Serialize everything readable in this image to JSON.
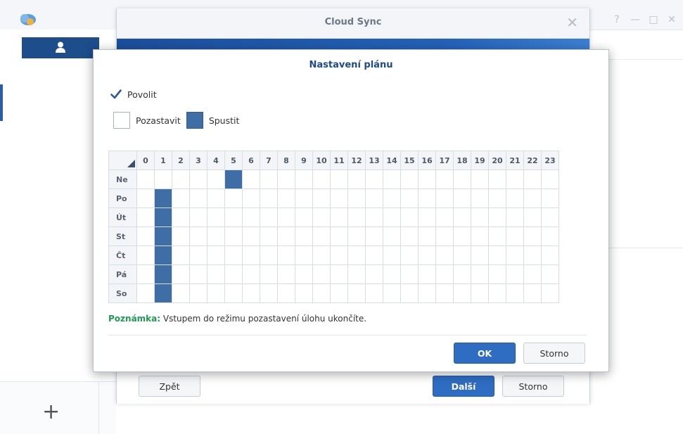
{
  "window_controls": [
    "?",
    "—",
    "□",
    "✕"
  ],
  "wizard": {
    "title": "Cloud Sync",
    "close": "✕",
    "back_label": "Zpět",
    "next_label": "Další",
    "cancel_label": "Storno"
  },
  "sidebar": {
    "add_label": "+"
  },
  "schedule": {
    "title": "Nastavení plánu",
    "enable_label": "Povolit",
    "enabled": true,
    "legend_pause_label": "Pozastavit",
    "legend_run_label": "Spustit",
    "hours": [
      "0",
      "1",
      "2",
      "3",
      "4",
      "5",
      "6",
      "7",
      "8",
      "9",
      "10",
      "11",
      "12",
      "13",
      "14",
      "15",
      "16",
      "17",
      "18",
      "19",
      "20",
      "21",
      "22",
      "23"
    ],
    "days": [
      {
        "label": "Ne",
        "active_hours": [
          5
        ]
      },
      {
        "label": "Po",
        "active_hours": [
          1
        ]
      },
      {
        "label": "Út",
        "active_hours": [
          1
        ]
      },
      {
        "label": "St",
        "active_hours": [
          1
        ]
      },
      {
        "label": "Čt",
        "active_hours": [
          1
        ]
      },
      {
        "label": "Pá",
        "active_hours": [
          1
        ]
      },
      {
        "label": "So",
        "active_hours": [
          1
        ]
      }
    ],
    "note_key": "Poznámka:",
    "note_text": " Vstupem do režimu pozastavení úlohu ukončíte.",
    "ok_label": "OK",
    "cancel_label": "Storno"
  },
  "colors": {
    "accent": "#2e6dc2",
    "run_cell": "#3f6da6",
    "note_key": "#1f9a55",
    "title": "#1c4a8a"
  }
}
